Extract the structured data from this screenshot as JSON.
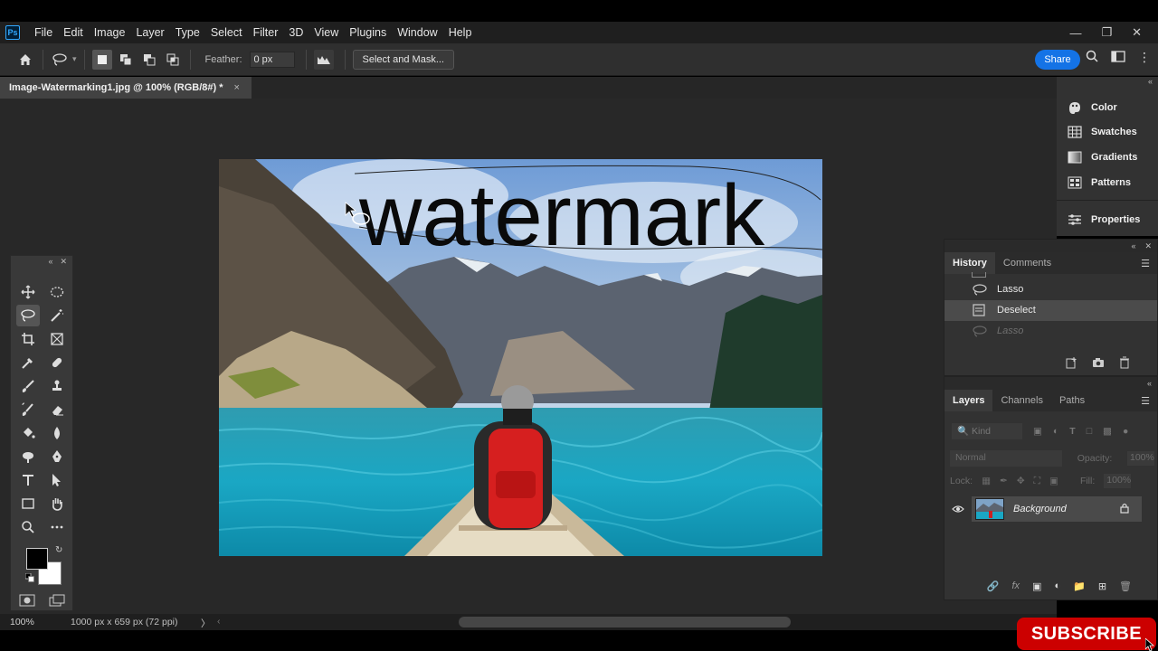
{
  "app": {
    "logo": "Ps"
  },
  "menu": [
    "File",
    "Edit",
    "Image",
    "Layer",
    "Type",
    "Select",
    "Filter",
    "3D",
    "View",
    "Plugins",
    "Window",
    "Help"
  ],
  "window_controls": [
    "minimize-icon",
    "restore-icon",
    "close-icon"
  ],
  "options": {
    "feather_label": "Feather:",
    "feather_value": "0 px",
    "select_mask_label": "Select and Mask...",
    "share_label": "Share"
  },
  "document": {
    "tab_title": "Image-Watermarking1.jpg @ 100% (RGB/8#) *",
    "tab_close": "×",
    "watermark_text": "watermark"
  },
  "right_panels": [
    {
      "label": "Color",
      "icon": "color-icon"
    },
    {
      "label": "Swatches",
      "icon": "swatches-icon"
    },
    {
      "label": "Gradients",
      "icon": "gradients-icon"
    },
    {
      "label": "Patterns",
      "icon": "patterns-icon"
    },
    {
      "label": "Properties",
      "icon": "properties-icon"
    }
  ],
  "history": {
    "tabs": [
      "History",
      "Comments"
    ],
    "items": [
      {
        "label": "Lasso",
        "state": "normal"
      },
      {
        "label": "Deselect",
        "state": "selected"
      },
      {
        "label": "Lasso",
        "state": "undone"
      }
    ]
  },
  "layers": {
    "tabs": [
      "Layers",
      "Channels",
      "Paths"
    ],
    "filter_placeholder": "Kind",
    "blend_mode": "Normal",
    "opacity_label": "Opacity:",
    "opacity_value": "100%",
    "lock_label": "Lock:",
    "fill_label": "Fill:",
    "fill_value": "100%",
    "items": [
      {
        "name": "Background",
        "visible": true,
        "locked": true
      }
    ]
  },
  "status": {
    "zoom": "100%",
    "dimensions": "1000 px x 659 px (72 ppi)",
    "arrow": "〉"
  },
  "overlay": {
    "subscribe": "SUBSCRIBE"
  },
  "colors": {
    "accent": "#1473e6",
    "foreground": "#000000",
    "background": "#ffffff",
    "subscribe": "#cc0000"
  }
}
